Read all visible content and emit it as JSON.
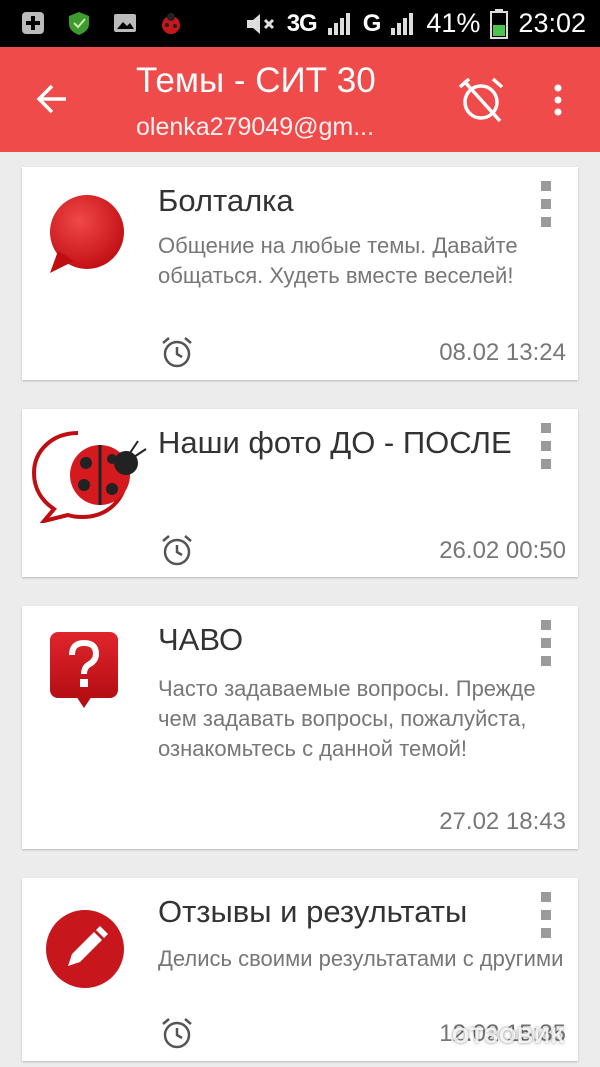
{
  "status_bar": {
    "network": "3G",
    "network2": "G",
    "battery": "41%",
    "time": "23:02"
  },
  "app_bar": {
    "title": "Темы - СИТ 30",
    "subtitle": "olenka279049@gm..."
  },
  "topics": [
    {
      "title": "Болталка",
      "description": "Общение на любые темы. Давайте общаться. Худеть вместе веселей!",
      "time": "08.02 13:24",
      "icon": "speech-bubble-icon"
    },
    {
      "title": "Наши фото ДО - ПОСЛЕ",
      "description": "",
      "time": "26.02 00:50",
      "icon": "ladybug-bubble-icon"
    },
    {
      "title": "ЧАВО",
      "description": "Часто задаваемые вопросы. Прежде чем задавать вопросы, пожалуйста, ознакомьтесь с данной темой!",
      "time": "27.02 18:43",
      "icon": "question-bubble-icon"
    },
    {
      "title": "Отзывы и результаты",
      "description": "Делись своими результатами с другими",
      "time": "12.02 15:35",
      "icon": "pencil-circle-icon"
    }
  ],
  "watermark": "ОТЗОВИК",
  "colors": {
    "accent": "#ef4b4b",
    "icon_red": "#c8161d",
    "text_primary": "#333333",
    "text_secondary": "#777777"
  }
}
